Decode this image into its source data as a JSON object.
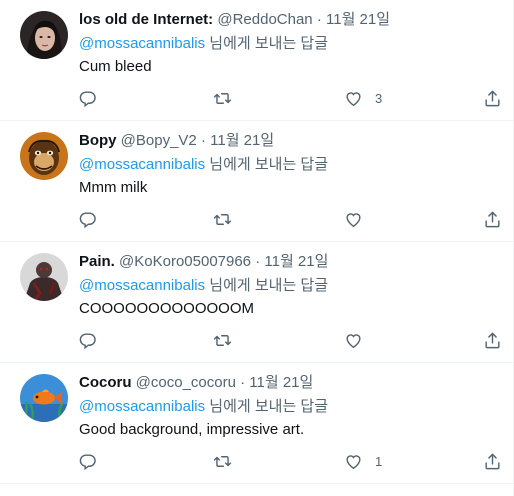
{
  "tweets": [
    {
      "name": "los old de Internet:",
      "handle": "@ReddoChan",
      "dot": "·",
      "date": "11월 21일",
      "reply_mention": "@mossacannibalis",
      "reply_suffix": " 님에게 보내는 답글",
      "text": "Cum bleed",
      "like_count": "3",
      "avatar": "person-dark-hair"
    },
    {
      "name": "Bopy",
      "handle": "@Bopy_V2",
      "dot": "·",
      "date": "11월 21일",
      "reply_mention": "@mossacannibalis",
      "reply_suffix": " 님에게 보내는 답글",
      "text": "Mmm milk",
      "like_count": "",
      "avatar": "ape-illustration"
    },
    {
      "name": "Pain.",
      "handle": "@KoKoro05007966",
      "dot": "·",
      "date": "11월 21일",
      "reply_mention": "@mossacannibalis",
      "reply_suffix": " 님에게 보내는 답글",
      "text": "COOOOOOOOOOOOOM",
      "like_count": "",
      "avatar": "dark-figure"
    },
    {
      "name": "Cocoru",
      "handle": "@coco_cocoru",
      "dot": "·",
      "date": "11월 21일",
      "reply_mention": "@mossacannibalis",
      "reply_suffix": " 님에게 보내는 답글",
      "text": "Good background, impressive art.",
      "like_count": "1",
      "avatar": "goldfish"
    }
  ],
  "colors": {
    "accent": "#1d9bf0",
    "secondary_text": "#536471",
    "primary_text": "#0f1419",
    "divider": "#eff3f4"
  },
  "icons": [
    "reply-icon",
    "retweet-icon",
    "like-icon",
    "share-icon"
  ]
}
